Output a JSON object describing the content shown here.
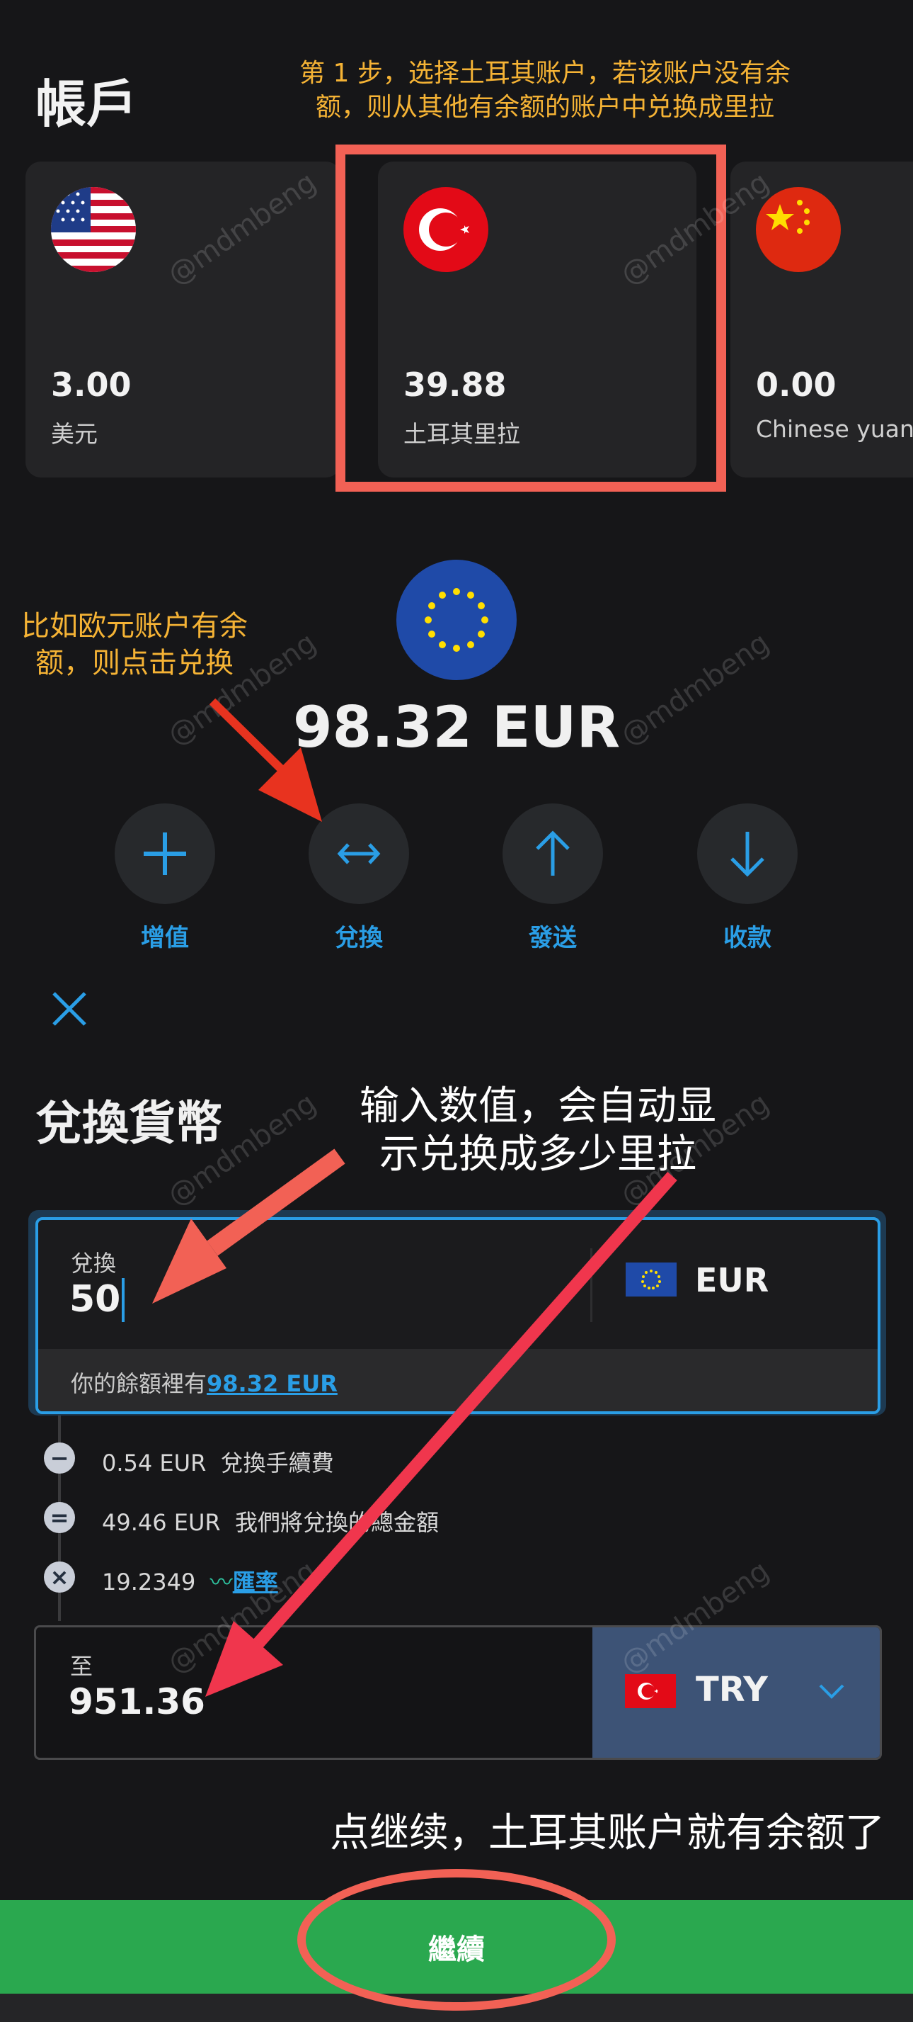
{
  "header": {
    "title": "帳戶"
  },
  "annotations": {
    "step1_line1": "第 1 步，选择土耳其账户，若该账户没有余",
    "step1_line2": "额，则从其他有余额的账户中兑换成里拉",
    "eur_line1": "比如欧元账户有余",
    "eur_line2": "额，则点击兑换",
    "input_line1": "输入数值，会自动显",
    "input_line2": "示兑换成多少里拉",
    "continue_note": "点继续，土耳其账户就有余额了"
  },
  "accounts": [
    {
      "amount": "3.00",
      "currency": "美元",
      "flag": "us-flag-icon"
    },
    {
      "amount": "39.88",
      "currency": "土耳其里拉",
      "flag": "turkey-flag-icon"
    },
    {
      "amount": "0.00",
      "currency": "Chinese yuan",
      "flag": "china-flag-icon"
    }
  ],
  "selected_balance": {
    "amount": "98.32 EUR",
    "flag": "eu-flag-icon"
  },
  "actions": [
    {
      "label": "增值",
      "icon": "plus-icon"
    },
    {
      "label": "兌換",
      "icon": "swap-icon"
    },
    {
      "label": "發送",
      "icon": "arrow-up-icon"
    },
    {
      "label": "收款",
      "icon": "arrow-down-icon"
    }
  ],
  "exchange": {
    "title": "兌換貨幣",
    "from_label": "兌換",
    "from_value": "50",
    "from_currency": "EUR",
    "balance_prefix": "你的餘額裡有",
    "balance_link": "98.32 EUR",
    "fees": [
      {
        "symbol": "−",
        "amount": "0.54 EUR",
        "desc": "兌換手續費"
      },
      {
        "symbol": "=",
        "amount": "49.46 EUR",
        "desc": "我們將兌換的總金額"
      },
      {
        "symbol": "×",
        "amount": "19.2349",
        "desc": "匯率"
      }
    ],
    "to_label": "至",
    "to_value": "951.36",
    "to_currency": "TRY"
  },
  "continue_button": "繼續",
  "watermark": "@mdmbeng",
  "colors": {
    "accent_blue": "#2a9ee6",
    "highlight_red": "#f26155",
    "arrow_red": "#f0352f",
    "continue_green": "#2aa84f",
    "annotation_yellow": "#f5b335"
  }
}
